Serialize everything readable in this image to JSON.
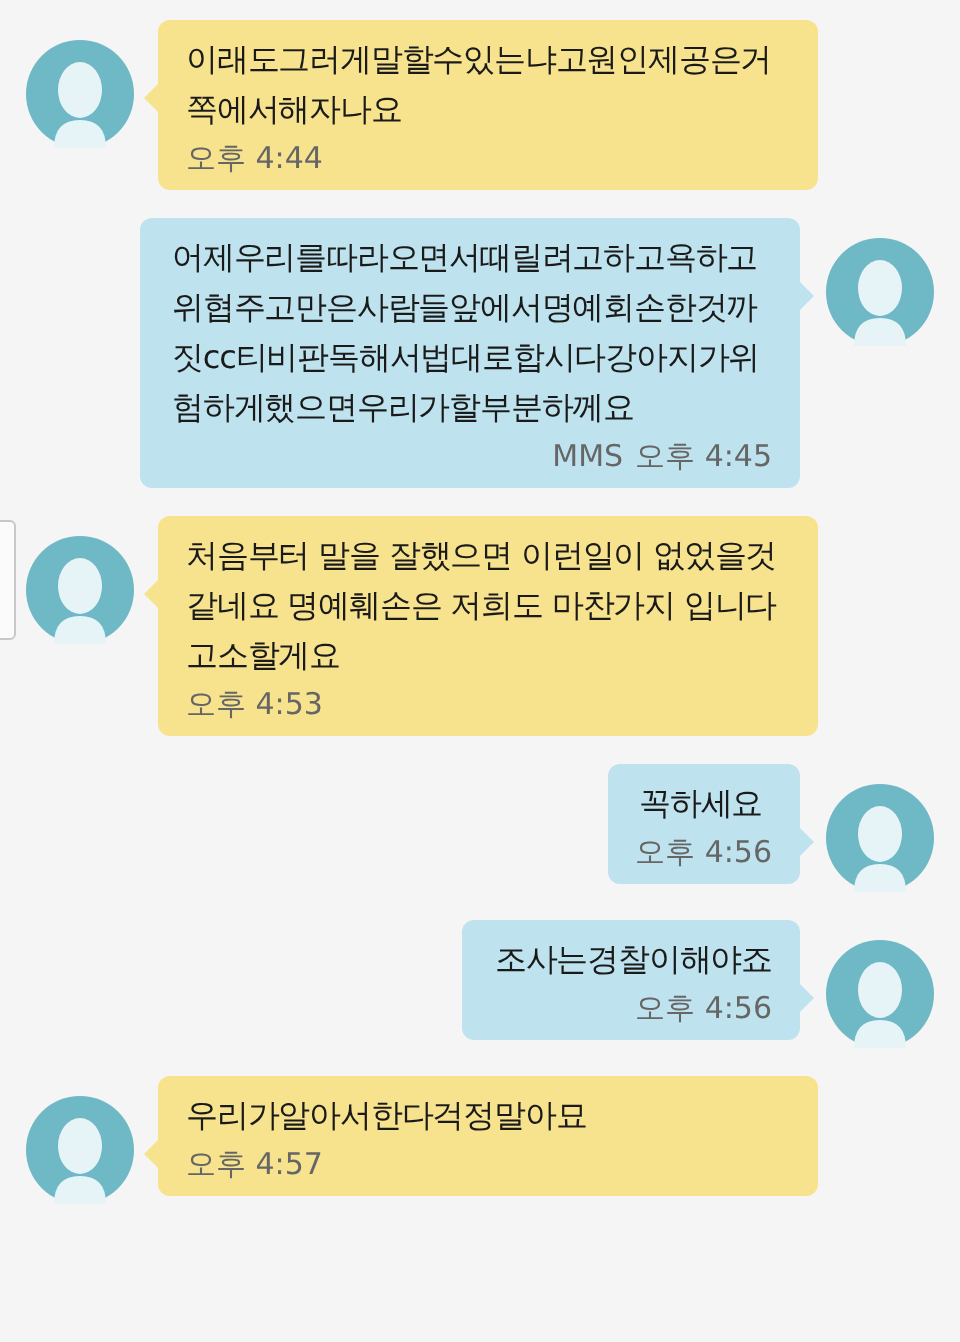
{
  "messages": [
    {
      "kind": "incoming",
      "text": "이래도그러게말할수있는냐고원인제공은거쪽에서해자나요",
      "time": "오후 4:44"
    },
    {
      "kind": "outgoing",
      "text": "어제우리를따라오면서때릴려고하고욕하고위협주고만은사람들앞에서명예회손한것까짓cc티비판독해서법대로합시다강아지가위험하게했으면우리가할부분하께요",
      "tag": "MMS",
      "time": "오후 4:45"
    },
    {
      "kind": "incoming",
      "text": "처음부터 말을 잘했으면 이런일이 없었을것 같네요 명예훼손은 저희도 마찬가지 입니다 고소할게요",
      "time": "오후 4:53"
    },
    {
      "kind": "outgoing",
      "text": "꼭하세요",
      "time": "오후 4:56"
    },
    {
      "kind": "outgoing",
      "text": "조사는경찰이해야죠",
      "time": "오후 4:56"
    },
    {
      "kind": "incoming",
      "text": "우리가알아서한다걱정말아묘",
      "time": "오후 4:57"
    }
  ]
}
